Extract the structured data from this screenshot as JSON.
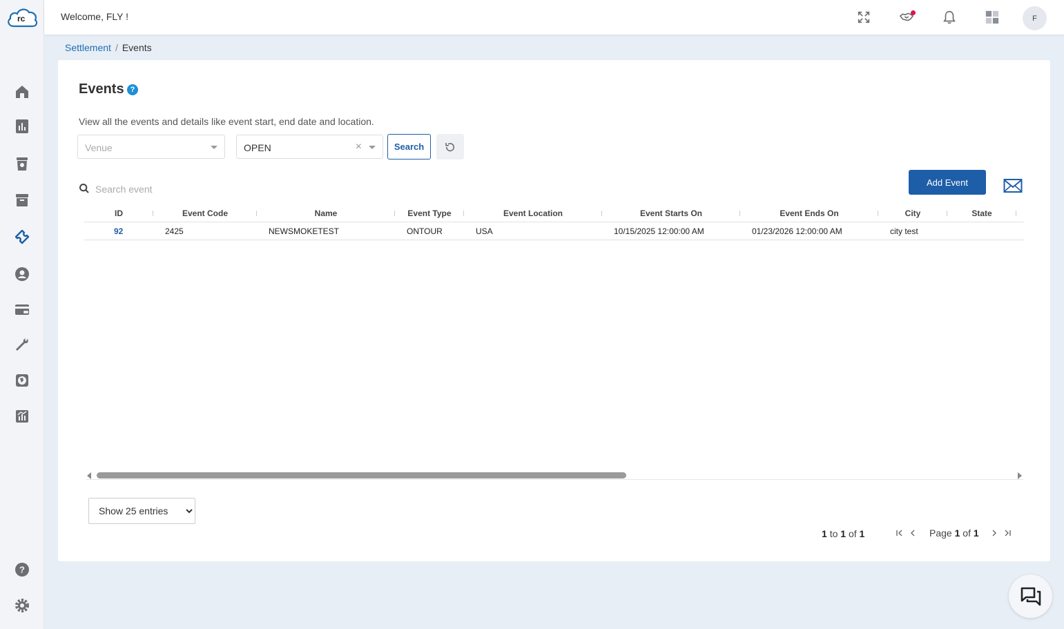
{
  "app": {
    "logo_text": "rc",
    "welcome": "Welcome, FLY !",
    "avatar_initial": "F",
    "brand_color": "#1e5ea8"
  },
  "sidebar": {
    "items": [
      {
        "icon": "home-icon"
      },
      {
        "icon": "bar-chart-icon"
      },
      {
        "icon": "trash-bin-icon"
      },
      {
        "icon": "archive-icon"
      },
      {
        "icon": "ticket-icon",
        "active": true
      },
      {
        "icon": "user-circle-icon"
      },
      {
        "icon": "credit-card-icon"
      },
      {
        "icon": "wrench-icon"
      },
      {
        "icon": "globe-icon"
      },
      {
        "icon": "analytics-icon"
      },
      {
        "icon": "help-icon"
      },
      {
        "icon": "settings-icon"
      }
    ]
  },
  "topbar": {
    "icons": [
      "fullscreen-icon",
      "handshake-icon",
      "bell-icon",
      "apps-grid-icon"
    ]
  },
  "breadcrumb": {
    "parent": "Settlement",
    "separator": "/",
    "current": "Events"
  },
  "page": {
    "title": "Events",
    "help": "?",
    "description": "View all the events and details like event start, end date and location."
  },
  "filters": {
    "venue_placeholder": "Venue",
    "status_value": "OPEN",
    "clear": "×",
    "search_label": "Search"
  },
  "search": {
    "placeholder": "Search event"
  },
  "actions": {
    "add_event": "Add Event"
  },
  "table": {
    "columns": [
      "ID",
      "Event Code",
      "Name",
      "Event Type",
      "Event Location",
      "Event Starts On",
      "Event Ends On",
      "City",
      "State"
    ],
    "rows": [
      {
        "id": "92",
        "code": "2425",
        "name": "NEWSMOKETEST",
        "type": "ONTOUR",
        "location": "USA",
        "starts": "10/15/2025 12:00:00 AM",
        "ends": "01/23/2026 12:00:00 AM",
        "city": "city test",
        "state": ""
      }
    ]
  },
  "pagination": {
    "entries_label": "Show 25 entries",
    "from": "1",
    "to_word": "to",
    "to": "1",
    "of_word": "of",
    "total": "1",
    "page_word": "Page",
    "page": "1",
    "pages": "1"
  }
}
